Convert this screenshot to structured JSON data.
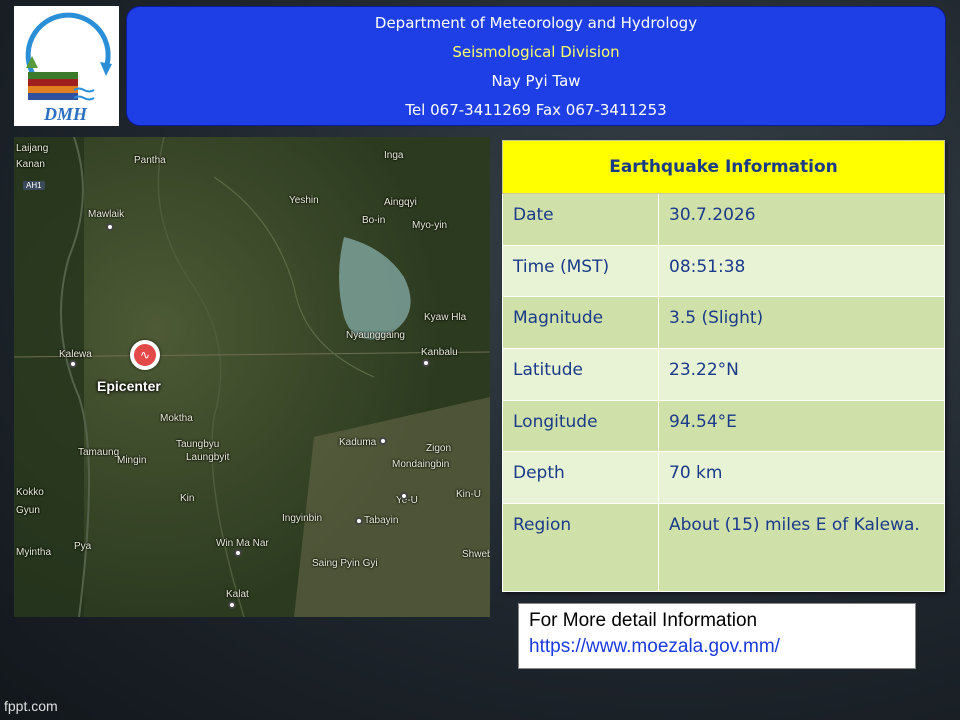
{
  "header": {
    "line1": "Department of Meteorology and Hydrology",
    "line2": "Seismological Division",
    "line3": "Nay Pyi Taw",
    "line4": "Tel 067-3411269 Fax 067-3411253"
  },
  "logo": {
    "text": "DMH"
  },
  "map": {
    "epicenter_label": "Epicenter",
    "road_badge": "AH1",
    "places": [
      "Laijang",
      "Kanan",
      "Pantha",
      "Inga",
      "Yeshin",
      "Mawlaik",
      "Aingqyi",
      "Bo-in",
      "Myo-yin",
      "Kyaw Hla",
      "Nyaunggaing",
      "Kalewa",
      "Kanbalu",
      "Moktha",
      "Tamaung",
      "Taungbyu",
      "Laungbyit",
      "Mingin",
      "Kaduma",
      "Zigon",
      "Mondaingbin",
      "Kin",
      "Ingyinbin",
      "Ye-U",
      "Kokko",
      "Gyun",
      "Pya",
      "Win Ma Nar",
      "Myintha",
      "Saing Pyin Gyi",
      "Tabayin",
      "Shwebo",
      "Kalat",
      "Kin-U"
    ]
  },
  "table": {
    "title": "Earthquake Information",
    "rows": [
      {
        "label": "Date",
        "value": "30.7.2026"
      },
      {
        "label": "Time (MST)",
        "value": "08:51:38"
      },
      {
        "label": "Magnitude",
        "value": "3.5 (Slight)"
      },
      {
        "label": "Latitude",
        "value": "23.22°N"
      },
      {
        "label": "Longitude",
        "value": "94.54°E"
      },
      {
        "label": "Depth",
        "value": "70 km"
      },
      {
        "label": "Region",
        "value": "About (15)  miles E of Kalewa."
      }
    ]
  },
  "more_info": {
    "text": "For More detail Information",
    "url": "https://www.moezala.gov.mm/"
  },
  "footer": {
    "credit": "fppt.com"
  },
  "colors": {
    "header_bg": "#1f3fe6",
    "header_subtitle": "#ffff66",
    "table_title_bg": "#ffff00",
    "table_text": "#1a3a8a",
    "row_odd": "#cfe0a8",
    "row_even": "#e8f2d4",
    "epicenter": "#e34949",
    "link": "#1a3adf"
  }
}
